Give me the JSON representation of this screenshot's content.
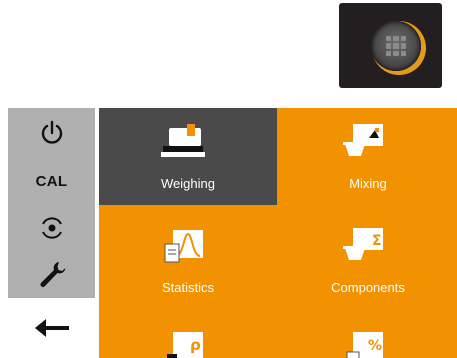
{
  "apps_button": {
    "icon": "app-grid-icon",
    "accent_color": "#e49a1b"
  },
  "sidebar": {
    "items": [
      {
        "icon": "power-icon"
      },
      {
        "label": "CAL"
      },
      {
        "icon": "target-icon"
      },
      {
        "icon": "wrench-icon"
      },
      {
        "icon": "back-arrow-icon"
      }
    ]
  },
  "tiles": [
    {
      "label": "Weighing",
      "icon": "weighing-scale-icon",
      "selected": true
    },
    {
      "label": "Mixing",
      "icon": "mixing-icon",
      "selected": false
    },
    {
      "label": "Statistics",
      "icon": "statistics-icon",
      "selected": false
    },
    {
      "label": "Components",
      "icon": "components-icon",
      "selected": false
    },
    {
      "label": "",
      "icon": "density-icon",
      "selected": false
    },
    {
      "label": "",
      "icon": "percent-weighing-icon",
      "selected": false
    }
  ],
  "colors": {
    "main_bg": "#f29200",
    "sidebar_bg": "#b0b0b0",
    "selected_tile": "#4a4a4a"
  }
}
